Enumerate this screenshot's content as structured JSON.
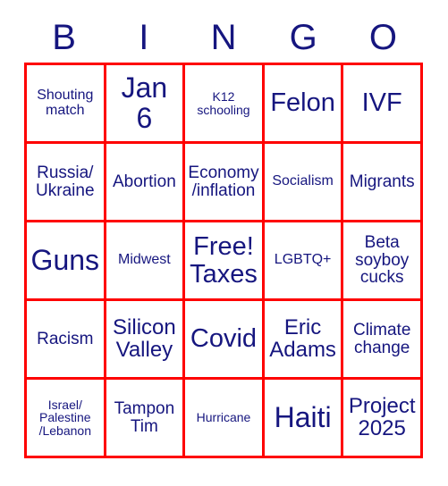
{
  "card": {
    "header": {
      "letters": [
        "B",
        "I",
        "N",
        "G",
        "O"
      ]
    },
    "colors": {
      "grid_border": "#fe0000",
      "text": "#16167f",
      "background": "#ffffff"
    },
    "rows": [
      [
        {
          "text": "Shouting\nmatch",
          "size": "s-sm"
        },
        {
          "text": "Jan\n6",
          "size": "s-xxl"
        },
        {
          "text": "K12\nschooling",
          "size": "s-xs"
        },
        {
          "text": "Felon",
          "size": "s-xl"
        },
        {
          "text": "IVF",
          "size": "s-xl"
        }
      ],
      [
        {
          "text": "Russia/\nUkraine",
          "size": "s-md"
        },
        {
          "text": "Abortion",
          "size": "s-md"
        },
        {
          "text": "Economy\n/inflation",
          "size": "s-md"
        },
        {
          "text": "Socialism",
          "size": "s-sm"
        },
        {
          "text": "Migrants",
          "size": "s-md"
        }
      ],
      [
        {
          "text": "Guns",
          "size": "s-xxl"
        },
        {
          "text": "Midwest",
          "size": "s-sm"
        },
        {
          "text": "Free!\nTaxes",
          "size": "s-xl"
        },
        {
          "text": "LGBTQ+",
          "size": "s-sm"
        },
        {
          "text": "Beta\nsoyboy\ncucks",
          "size": "s-md"
        }
      ],
      [
        {
          "text": "Racism",
          "size": "s-md"
        },
        {
          "text": "Silicon\nValley",
          "size": "s-lg"
        },
        {
          "text": "Covid",
          "size": "s-xl"
        },
        {
          "text": "Eric\nAdams",
          "size": "s-lg"
        },
        {
          "text": "Climate\nchange",
          "size": "s-md"
        }
      ],
      [
        {
          "text": "Israel/\nPalestine\n/Lebanon",
          "size": "s-xs"
        },
        {
          "text": "Tampon\nTim",
          "size": "s-md"
        },
        {
          "text": "Hurricane",
          "size": "s-xs"
        },
        {
          "text": "Haiti",
          "size": "s-xxl"
        },
        {
          "text": "Project\n2025",
          "size": "s-lg"
        }
      ]
    ]
  }
}
